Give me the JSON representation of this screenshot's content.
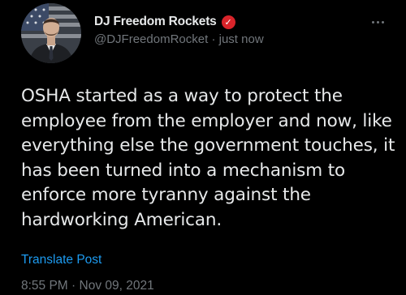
{
  "post": {
    "author": {
      "display_name": "DJ Freedom Rockets",
      "verified_badge_glyph": "✓",
      "handle": "@DJFreedomRocket",
      "separator": "·",
      "relative_time": "just now"
    },
    "text": "OSHA started as a way to protect the\nemployee from the employer and now, like\neverything else the government touches, it\nhas been turned into a mechanism to\nenforce more tyranny against the\nhardworking American.",
    "translate_label": "Translate Post",
    "timestamp": {
      "time": "8:55 PM",
      "separator": "·",
      "date": "Nov 09, 2021"
    }
  },
  "icons": {
    "more": "more-horizontal-icon",
    "verified": "verified-badge-icon",
    "avatar": "avatar-image"
  },
  "colors": {
    "background": "#000000",
    "text_primary": "#e7e9ea",
    "text_secondary": "#71767b",
    "link": "#1d9bf0",
    "badge": "#d9242a"
  }
}
